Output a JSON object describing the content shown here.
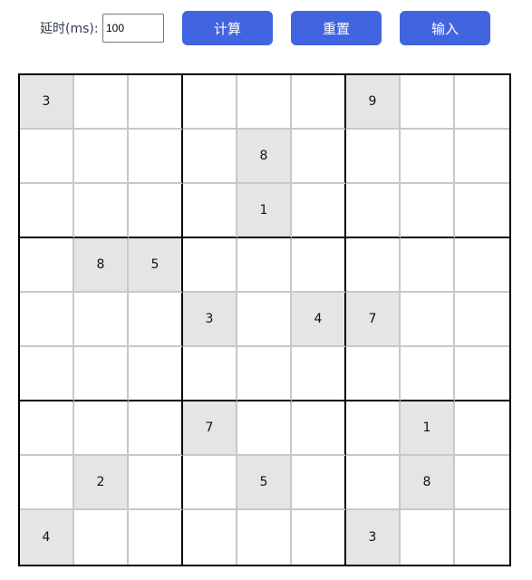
{
  "toolbar": {
    "delay_label": "延时(ms):",
    "delay_value": "100",
    "calc_label": "计算",
    "reset_label": "重置",
    "input_label": "输入"
  },
  "colors": {
    "button_bg": "#4165e0",
    "given_cell_bg": "#e5e5e5",
    "box_border": "#000000",
    "cell_border": "#c8c8c8"
  },
  "board": [
    [
      "3",
      "",
      "",
      "",
      "",
      "",
      "9",
      "",
      ""
    ],
    [
      "",
      "",
      "",
      "",
      "8",
      "",
      "",
      "",
      ""
    ],
    [
      "",
      "",
      "",
      "",
      "1",
      "",
      "",
      "",
      ""
    ],
    [
      "",
      "8",
      "5",
      "",
      "",
      "",
      "",
      "",
      ""
    ],
    [
      "",
      "",
      "",
      "3",
      "",
      "4",
      "7",
      "",
      ""
    ],
    [
      "",
      "",
      "",
      "",
      "",
      "",
      "",
      "",
      ""
    ],
    [
      "",
      "",
      "",
      "7",
      "",
      "",
      "",
      "1",
      ""
    ],
    [
      "",
      "2",
      "",
      "",
      "5",
      "",
      "",
      "8",
      ""
    ],
    [
      "4",
      "",
      "",
      "",
      "",
      "",
      "3",
      "",
      ""
    ]
  ]
}
